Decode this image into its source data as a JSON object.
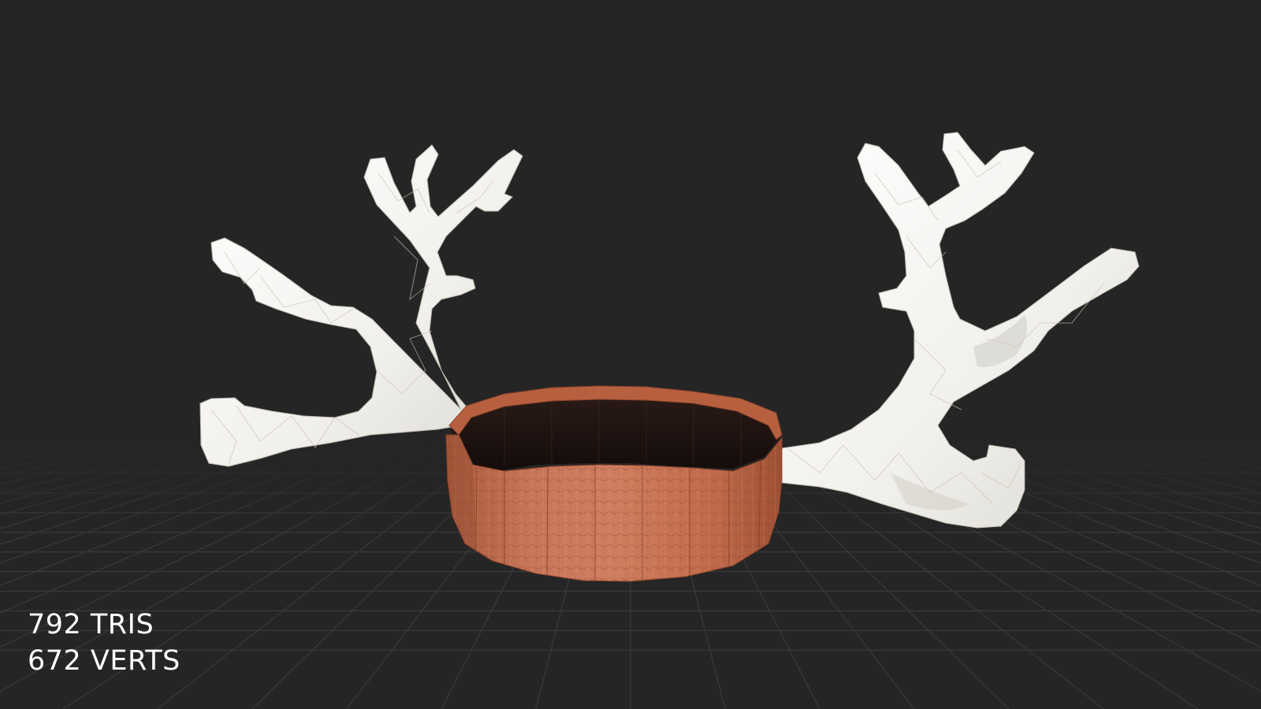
{
  "viewport": {
    "background_color": "#252525",
    "grid_color": "#3a3a3a",
    "model": {
      "antler_color": "#f4f3ef",
      "band_color": "#c4714f",
      "band_inner_color": "#1f1412"
    }
  },
  "stats": {
    "tris": "792 TRIS",
    "verts": "672 VERTS"
  }
}
